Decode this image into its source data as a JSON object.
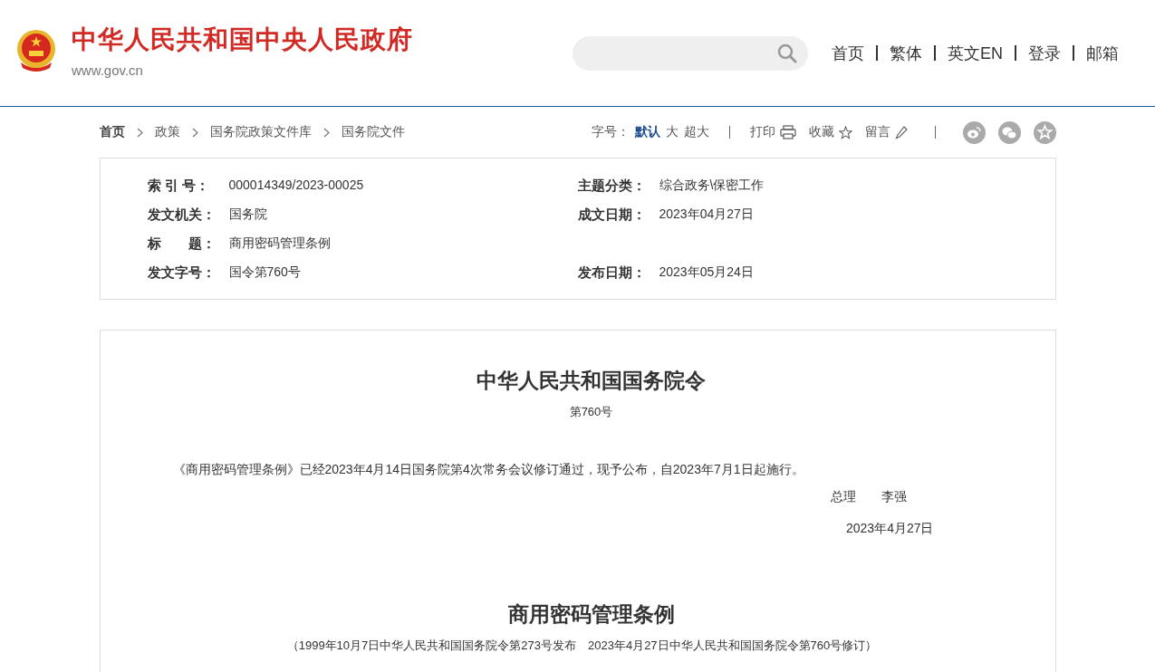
{
  "header": {
    "site_title": "中华人民共和国中央人民政府",
    "site_domain": "www.gov.cn",
    "nav": [
      "首页",
      "繁体",
      "英文EN",
      "登录",
      "邮箱"
    ]
  },
  "breadcrumb": [
    "首页",
    "政策",
    "国务院政策文件库",
    "国务院文件"
  ],
  "toolbar": {
    "font_label": "字号：",
    "font_sizes": [
      {
        "label": "默认",
        "selected": true
      },
      {
        "label": "大",
        "selected": false
      },
      {
        "label": "超大",
        "selected": false
      }
    ],
    "actions": [
      {
        "label": "打印",
        "kind": "print"
      },
      {
        "label": "收藏",
        "kind": "star"
      },
      {
        "label": "留言",
        "kind": "pencil"
      }
    ]
  },
  "meta": [
    {
      "label": "索 引 号：",
      "value": "000014349/2023-00025",
      "right_label": "主题分类：",
      "right_value": "综合政务\\保密工作"
    },
    {
      "label": "发文机关：",
      "value": "国务院",
      "right_label": "成文日期：",
      "right_value": "2023年04月27日"
    },
    {
      "label": "标　　题：",
      "value": "商用密码管理条例"
    },
    {
      "label": "发文字号：",
      "value": "国令第760号",
      "right_label": "发布日期：",
      "right_value": "2023年05月24日"
    }
  ],
  "document": {
    "order_title": "中华人民共和国国务院令",
    "order_number": "第760号",
    "body": "《商用密码管理条例》已经2023年4月14日国务院第4次常务会议修订通过，现予公布，自2023年7月1日起施行。",
    "signatory": "总理　　李强",
    "sign_date": "2023年4月27日",
    "regulation_title": "商用密码管理条例",
    "history": "（1999年10月7日中华人民共和国国务院令第273号发布　2023年4月27日中华人民共和国国务院令第760号修订）"
  }
}
